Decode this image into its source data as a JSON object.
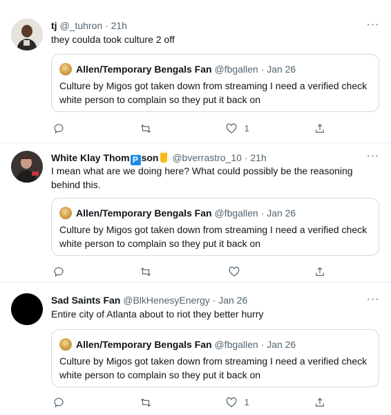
{
  "tweets": [
    {
      "name": "tj",
      "handle": "@_tuhron",
      "sep": "·",
      "time": "21h",
      "text": "they coulda took culture 2 off",
      "quote": {
        "name": "Allen/Temporary Bengals Fan",
        "handle": "@fbgallen",
        "sep": "·",
        "time": "Jan 26",
        "text": "Culture by Migos got taken down from streaming I need a verified check white person to complain so they put it back on"
      },
      "like_count": "1"
    },
    {
      "name_part1": "White Klay Thom",
      "name_emoji_letter": "P",
      "name_part2": "son",
      "handle": "@bverrastro_10",
      "sep": "·",
      "time": "21h",
      "text": "I mean what are we doing here? What could possibly be the reasoning behind this.",
      "quote": {
        "name": "Allen/Temporary Bengals Fan",
        "handle": "@fbgallen",
        "sep": "·",
        "time": "Jan 26",
        "text": "Culture by Migos got taken down from streaming I need a verified check white person to complain so they put it back on"
      },
      "like_count": ""
    },
    {
      "name": "Sad Saints Fan",
      "handle": "@BlkHenesyEnergy",
      "sep": "·",
      "time": "Jan 26",
      "text": "Entire city of Atlanta about to riot they better hurry",
      "quote": {
        "name": "Allen/Temporary Bengals Fan",
        "handle": "@fbgallen",
        "sep": "·",
        "time": "Jan 26",
        "text": "Culture by Migos got taken down from streaming I need a verified check white person to complain so they put it back on"
      },
      "like_count": "1"
    }
  ],
  "icons": {
    "reply": "reply-icon",
    "retweet": "retweet-icon",
    "like": "heart-icon",
    "share": "share-icon",
    "more": "more-icon"
  },
  "more_glyph": "···",
  "colors": {
    "text": "#0f1419",
    "secondary": "#536471",
    "border": "#cfd9de"
  }
}
